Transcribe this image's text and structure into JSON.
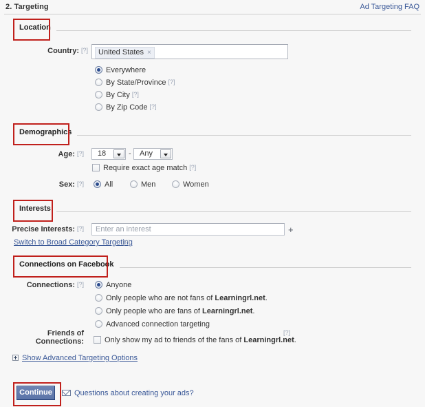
{
  "header": {
    "step_title": "2. Targeting",
    "faq_link": "Ad Targeting FAQ"
  },
  "sections": {
    "location": {
      "heading": "Location",
      "country_label": "Country:",
      "country_help": "[?]",
      "country_token": "United States",
      "token_remove": "×",
      "options": [
        {
          "label": "Everywhere",
          "help": "",
          "checked": true
        },
        {
          "label": "By State/Province",
          "help": "[?]",
          "checked": false
        },
        {
          "label": "By City",
          "help": "[?]",
          "checked": false
        },
        {
          "label": "By Zip Code",
          "help": "[?]",
          "checked": false
        }
      ]
    },
    "demographics": {
      "heading": "Demographics",
      "age_label": "Age:",
      "age_help": "[?]",
      "age_min": "18",
      "age_max": "Any",
      "age_separator": "-",
      "exact_age_label": "Require exact age match",
      "exact_age_help": "[?]",
      "exact_age_checked": false,
      "sex_label": "Sex:",
      "sex_help": "[?]",
      "sex_options": [
        {
          "label": "All",
          "checked": true
        },
        {
          "label": "Men",
          "checked": false
        },
        {
          "label": "Women",
          "checked": false
        }
      ]
    },
    "interests": {
      "heading": "Interests",
      "precise_label": "Precise Interests:",
      "precise_help": "[?]",
      "precise_placeholder": "Enter an interest",
      "precise_value": "",
      "add_button": "+",
      "switch_link": "Switch to Broad Category Targeting",
      "switch_help": "[?]"
    },
    "connections": {
      "heading": "Connections on Facebook",
      "connections_label": "Connections:",
      "connections_help": "[?]",
      "options": [
        {
          "label": "Anyone",
          "bold": "",
          "suffix": "",
          "checked": true
        },
        {
          "label": "Only people who are not fans of ",
          "bold": "Learningrl.net",
          "suffix": ".",
          "checked": false
        },
        {
          "label": "Only people who are fans of ",
          "bold": "Learningrl.net",
          "suffix": ".",
          "checked": false
        },
        {
          "label": "Advanced connection targeting",
          "bold": "",
          "suffix": "",
          "checked": false
        }
      ],
      "friends_label_line1": "Friends of",
      "friends_label_line2": "Connections:",
      "friends_option_prefix": "Only show my ad to friends of the fans of ",
      "friends_option_bold": "Learningrl.net",
      "friends_option_suffix": ".",
      "friends_help": "[?]",
      "friends_checked": false
    }
  },
  "footer": {
    "advanced_toggle": "Show Advanced Targeting Options",
    "continue_label": "Continue",
    "questions_link": "Questions about creating your ads?"
  },
  "colors": {
    "annotation_red": "#c0201c",
    "link_blue": "#3b5998",
    "button_blue": "#5b74a8",
    "page_background": "#f7f7f7"
  }
}
